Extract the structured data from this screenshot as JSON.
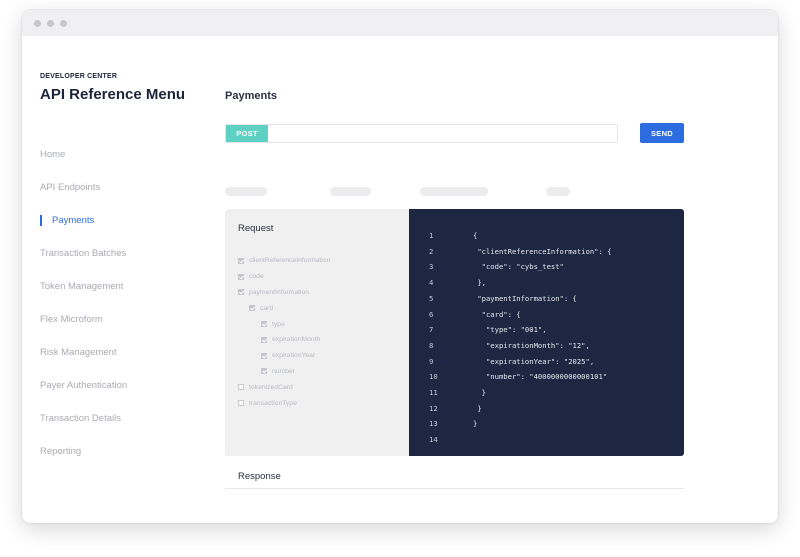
{
  "sidebar": {
    "eyebrow": "DEVELOPER CENTER",
    "title": "API Reference Menu",
    "items": [
      {
        "label": "Home",
        "active": false
      },
      {
        "label": "API Endpoints",
        "active": false
      },
      {
        "label": "Payments",
        "active": true
      },
      {
        "label": "Transaction Batches",
        "active": false
      },
      {
        "label": "Token Management",
        "active": false
      },
      {
        "label": "Flex Microform",
        "active": false
      },
      {
        "label": "Risk Management",
        "active": false
      },
      {
        "label": "Payer Authentication",
        "active": false
      },
      {
        "label": "Transaction Details",
        "active": false
      },
      {
        "label": "Reporting",
        "active": false
      }
    ]
  },
  "main": {
    "title": "Payments",
    "method": "POST",
    "url": "",
    "send_label": "SEND",
    "request_label": "Request",
    "response_label": "Response",
    "fields": [
      {
        "label": "clientReferenceInformation",
        "checked": true,
        "level": 0
      },
      {
        "label": "code",
        "checked": true,
        "level": 0
      },
      {
        "label": "paymentInformation",
        "checked": true,
        "level": 0
      },
      {
        "label": "card",
        "checked": true,
        "level": 1
      },
      {
        "label": "type",
        "checked": true,
        "level": 2
      },
      {
        "label": "expirationMonth",
        "checked": true,
        "level": 2
      },
      {
        "label": "expirationYear",
        "checked": true,
        "level": 2
      },
      {
        "label": "number",
        "checked": true,
        "level": 2
      },
      {
        "label": "tokenizedCard",
        "checked": false,
        "level": 0
      },
      {
        "label": "transactionType",
        "checked": false,
        "level": 0
      }
    ],
    "code": [
      {
        "n": "1",
        "text": "{"
      },
      {
        "n": "2",
        "text": " \"clientReferenceInformation\": {"
      },
      {
        "n": "3",
        "text": "  \"code\": \"cybs_test\""
      },
      {
        "n": "4",
        "text": " },"
      },
      {
        "n": "5",
        "text": " \"paymentInformation\": {"
      },
      {
        "n": "6",
        "text": "  \"card\": {"
      },
      {
        "n": "7",
        "text": "   \"type\": \"001\","
      },
      {
        "n": "8",
        "text": "   \"expirationMonth\": \"12\","
      },
      {
        "n": "9",
        "text": "   \"expirationYear\": \"2025\","
      },
      {
        "n": "10",
        "text": "   \"number\": \"4000000000000101\""
      },
      {
        "n": "11",
        "text": "  }"
      },
      {
        "n": "12",
        "text": " }"
      },
      {
        "n": "13",
        "text": "}"
      },
      {
        "n": "14",
        "text": ""
      }
    ]
  },
  "colors": {
    "accent": "#2d6ce0",
    "method": "#5fd0c4",
    "code_bg": "#1e2742"
  }
}
